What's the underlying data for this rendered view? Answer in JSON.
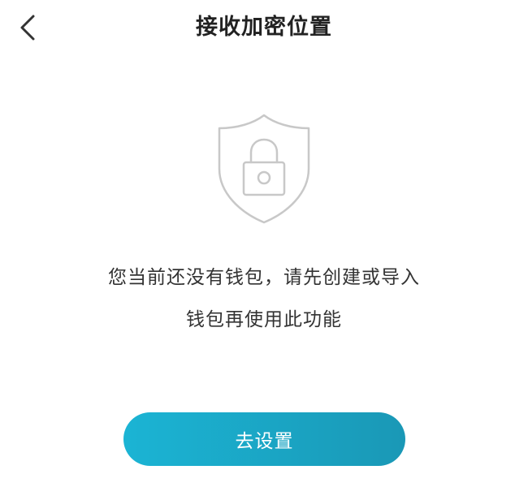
{
  "header": {
    "title": "接收加密位置",
    "back_icon": "chevron-left-icon"
  },
  "empty_state": {
    "icon": "shield-lock-icon",
    "message_line1": "您当前还没有钱包，请先创建或导入",
    "message_line2": "钱包再使用此功能"
  },
  "action": {
    "button_label": "去设置"
  },
  "colors": {
    "accent_start": "#1bb4d4",
    "accent_end": "#1a98b6",
    "icon_stroke": "#c8c8c8"
  }
}
